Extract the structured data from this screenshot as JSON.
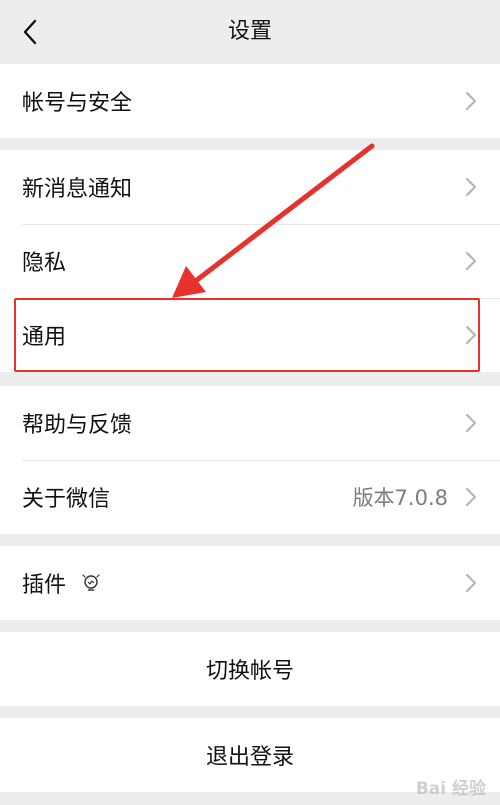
{
  "nav": {
    "title": "设置"
  },
  "groups": [
    {
      "items": [
        {
          "label": "帐号与安全"
        }
      ]
    },
    {
      "items": [
        {
          "label": "新消息通知"
        },
        {
          "label": "隐私"
        },
        {
          "label": "通用"
        }
      ]
    },
    {
      "items": [
        {
          "label": "帮助与反馈"
        },
        {
          "label": "关于微信",
          "value": "版本7.0.8"
        }
      ]
    },
    {
      "items": [
        {
          "label": "插件",
          "icon": "lightbulb-icon"
        }
      ]
    }
  ],
  "actions": {
    "switch_account": "切换帐号",
    "logout": "退出登录"
  },
  "annotation": {
    "highlight_color": "#e6312c"
  },
  "watermark": "Bai 经验"
}
